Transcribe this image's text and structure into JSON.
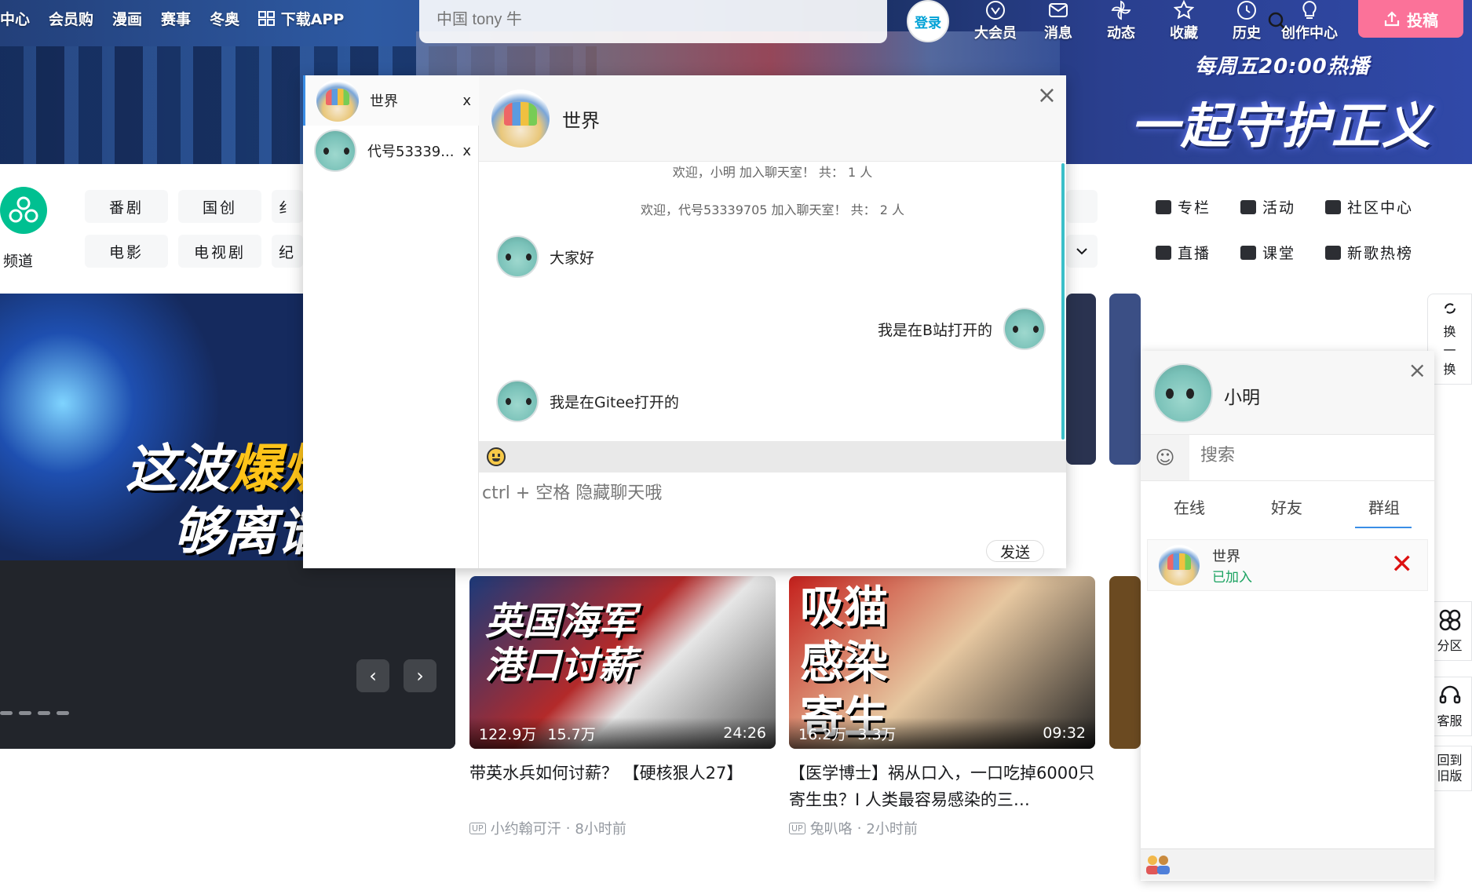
{
  "header": {
    "nav_left": [
      "中心",
      "会员购",
      "漫画",
      "赛事",
      "冬奥",
      "下载APP"
    ],
    "search_placeholder": "中国 tony 牛",
    "login_label": "登录",
    "nav_right": [
      "大会员",
      "消息",
      "动态",
      "收藏",
      "历史",
      "创作中心"
    ],
    "upload_label": "投稿",
    "banner_sub": "每周五20:00热播",
    "banner_slogan": "一起守护正义"
  },
  "channels": {
    "label": "频道",
    "chips_row1": [
      "番剧",
      "国创",
      "纟"
    ],
    "chips_row2": [
      "电影",
      "电视剧",
      "纪"
    ],
    "side_links": [
      "专栏",
      "活动",
      "社区中心",
      "直播",
      "课堂",
      "新歌热榜"
    ],
    "refresh_label": "换一换"
  },
  "carousel": {
    "headline_yellow": "爆炉",
    "headline_white": "这波",
    "headline2": "够离谱"
  },
  "cards": [
    {
      "thumb_text": "英国海军港口讨薪",
      "views": "122.9万",
      "likes": "15.7万",
      "duration": "24:26",
      "title": "带英水兵如何讨薪？ 【硬核狠人27】",
      "author": "小约翰可汗",
      "time": "8小时前"
    },
    {
      "thumb_text": "吸猫感染寄生虫",
      "views": "16.2万",
      "likes": "3.3万",
      "duration": "09:32",
      "title": "【医学博士】祸从口入，一口吃掉6000只寄生虫？I 人类最容易感染的三…",
      "author": "兔叭咯",
      "time": "2小时前"
    }
  ],
  "floating": {
    "partition": "分区",
    "service": "客服",
    "old_version": "回到旧版"
  },
  "chat": {
    "sessions": [
      {
        "name": "世界",
        "close": "x"
      },
      {
        "name": "代号53339...",
        "close": "x"
      }
    ],
    "title": "世界",
    "close": "×",
    "system_messages": [
      "欢迎，小明 加入聊天室！ 共： 1 人",
      "欢迎，代号53339705 加入聊天室！ 共： 2 人"
    ],
    "messages": [
      {
        "side": "left",
        "text": "大家好"
      },
      {
        "side": "right",
        "text": "我是在B站打开的"
      },
      {
        "side": "left",
        "text": "我是在Gitee打开的"
      }
    ],
    "input_placeholder": "ctrl + 空格 隐藏聊天哦",
    "send_label": "发送"
  },
  "contacts": {
    "username": "小明",
    "close": "×",
    "search_placeholder": "搜索",
    "tabs": [
      "在线",
      "好友",
      "群组"
    ],
    "active_tab": "群组",
    "group": {
      "name": "世界",
      "status": "已加入"
    }
  }
}
